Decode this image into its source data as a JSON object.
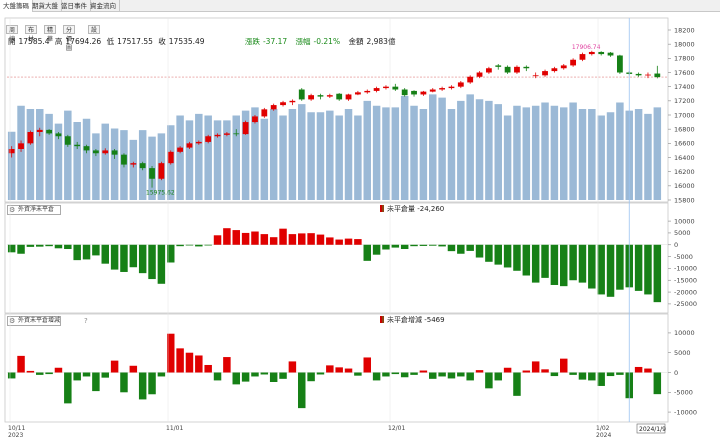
{
  "tabs": [
    "大盤籌碼",
    "期貨大盤",
    "當日事件",
    "資金流向"
  ],
  "subtabs": [
    "周線",
    "布林",
    "精華",
    "分價圖",
    "設"
  ],
  "ohlc": {
    "open_label": "開",
    "open": "17585.4",
    "high_label": "高",
    "high": "17694.26",
    "low_label": "低",
    "low": "17517.55",
    "close_label": "收",
    "close": "17535.49",
    "change_label": "漲跌",
    "change": "-37.17",
    "pct_label": "漲幅",
    "pct": "-0.21%",
    "amount_label": "金額",
    "amount": "2,983億"
  },
  "panel2": {
    "selector": "外資淨未平倉",
    "label": "未平倉量",
    "value": "-24,260"
  },
  "panel3": {
    "selector": "外資未平倉增減",
    "label": "未平倉增減",
    "value": "-5469",
    "help": "?"
  },
  "colors": {
    "up": "#e00000",
    "down": "#168016",
    "volume": "#9bb9d6",
    "hline": "#e08080",
    "cursor": "#9cc4f0",
    "ann_high": "#e040a0",
    "ann_low": "#168016"
  },
  "chart_data": [
    {
      "type": "candlestick",
      "name": "加權指數",
      "ylim": [
        15800,
        18200
      ],
      "yticks": [
        15800,
        16000,
        16200,
        16400,
        16600,
        16800,
        17000,
        17200,
        17400,
        17600,
        17800,
        18000,
        18200
      ],
      "annotations": [
        {
          "text": "17906.74",
          "color": "high"
        },
        {
          "text": "15975.62",
          "color": "low"
        }
      ],
      "ohlc": [
        [
          16460,
          16560,
          16400,
          16520
        ],
        [
          16520,
          16640,
          16480,
          16600
        ],
        [
          16600,
          16780,
          16580,
          16760
        ],
        [
          16760,
          16820,
          16700,
          16790
        ],
        [
          16790,
          16800,
          16720,
          16740
        ],
        [
          16740,
          16760,
          16660,
          16700
        ],
        [
          16700,
          16720,
          16550,
          16580
        ],
        [
          16580,
          16620,
          16520,
          16560
        ],
        [
          16560,
          16580,
          16460,
          16500
        ],
        [
          16500,
          16520,
          16420,
          16460
        ],
        [
          16460,
          16530,
          16440,
          16500
        ],
        [
          16500,
          16520,
          16380,
          16440
        ],
        [
          16440,
          16460,
          16260,
          16300
        ],
        [
          16300,
          16340,
          16260,
          16320
        ],
        [
          16320,
          16340,
          16220,
          16250
        ],
        [
          16250,
          16280,
          15975,
          16100
        ],
        [
          16100,
          16340,
          16080,
          16320
        ],
        [
          16320,
          16500,
          16300,
          16480
        ],
        [
          16480,
          16560,
          16460,
          16540
        ],
        [
          16540,
          16620,
          16520,
          16600
        ],
        [
          16600,
          16640,
          16580,
          16620
        ],
        [
          16620,
          16720,
          16600,
          16700
        ],
        [
          16700,
          16740,
          16680,
          16720
        ],
        [
          16720,
          16760,
          16700,
          16740
        ],
        [
          16740,
          16800,
          16700,
          16730
        ],
        [
          16730,
          16920,
          16720,
          16900
        ],
        [
          16900,
          17000,
          16880,
          16980
        ],
        [
          16980,
          17100,
          16960,
          17080
        ],
        [
          17080,
          17160,
          17060,
          17140
        ],
        [
          17140,
          17200,
          17120,
          17180
        ],
        [
          17180,
          17220,
          17140,
          17200
        ],
        [
          17360,
          17380,
          17200,
          17220
        ],
        [
          17220,
          17300,
          17200,
          17280
        ],
        [
          17280,
          17300,
          17220,
          17260
        ],
        [
          17260,
          17300,
          17240,
          17280
        ],
        [
          17300,
          17310,
          17200,
          17220
        ],
        [
          17220,
          17300,
          17200,
          17290
        ],
        [
          17290,
          17340,
          17280,
          17320
        ],
        [
          17320,
          17360,
          17300,
          17340
        ],
        [
          17340,
          17400,
          17320,
          17380
        ],
        [
          17380,
          17420,
          17360,
          17400
        ],
        [
          17400,
          17440,
          17340,
          17360
        ],
        [
          17360,
          17380,
          17260,
          17280
        ],
        [
          17340,
          17350,
          17260,
          17290
        ],
        [
          17290,
          17340,
          17270,
          17330
        ],
        [
          17330,
          17380,
          17320,
          17360
        ],
        [
          17360,
          17400,
          17340,
          17380
        ],
        [
          17380,
          17420,
          17360,
          17400
        ],
        [
          17400,
          17480,
          17380,
          17460
        ],
        [
          17460,
          17560,
          17440,
          17540
        ],
        [
          17540,
          17620,
          17520,
          17600
        ],
        [
          17600,
          17680,
          17580,
          17660
        ],
        [
          17700,
          17720,
          17640,
          17680
        ],
        [
          17680,
          17700,
          17580,
          17600
        ],
        [
          17600,
          17700,
          17580,
          17680
        ],
        [
          17680,
          17700,
          17620,
          17660
        ],
        [
          17560,
          17600,
          17520,
          17560
        ],
        [
          17560,
          17640,
          17540,
          17620
        ],
        [
          17620,
          17680,
          17600,
          17660
        ],
        [
          17660,
          17720,
          17640,
          17700
        ],
        [
          17700,
          17800,
          17680,
          17780
        ],
        [
          17780,
          17880,
          17760,
          17860
        ],
        [
          17860,
          17906.74,
          17840,
          17890
        ],
        [
          17890,
          17900,
          17840,
          17860
        ],
        [
          17880,
          17890,
          17820,
          17840
        ],
        [
          17840,
          17850,
          17580,
          17600
        ],
        [
          17600,
          17620,
          17560,
          17580
        ],
        [
          17580,
          17600,
          17540,
          17560
        ],
        [
          17560,
          17600,
          17520,
          17570
        ],
        [
          17585.4,
          17694.26,
          17517.55,
          17535.49
        ]
      ],
      "volume_ylim": [
        0,
        4000
      ],
      "volume": [
        2100,
        2900,
        2800,
        2800,
        2650,
        2350,
        2750,
        2400,
        2500,
        2050,
        2350,
        2200,
        2150,
        1850,
        2150,
        1950,
        2050,
        2300,
        2600,
        2450,
        2650,
        2600,
        2450,
        2450,
        2600,
        2750,
        2850,
        2500,
        2800,
        2600,
        2800,
        2950,
        2700,
        2700,
        2750,
        2600,
        2800,
        2600,
        3050,
        2900,
        2850,
        2850,
        3200,
        2900,
        2800,
        3250,
        3150,
        2800,
        3050,
        3250,
        3100,
        3050,
        2950,
        2600,
        2900,
        2850,
        2900,
        3000,
        2900,
        2850,
        3000,
        2800,
        2800,
        2600,
        2700,
        3000,
        2750,
        2800,
        2650,
        2850
      ]
    },
    {
      "type": "bar",
      "name": "未平倉量",
      "ylim": [
        -28000,
        13000
      ],
      "yticks": [
        -25000,
        -20000,
        -15000,
        -10000,
        -5000,
        0,
        5000,
        10000
      ],
      "values": [
        -3200,
        -3800,
        -900,
        -800,
        -600,
        -1500,
        -1800,
        -6500,
        -6200,
        -4500,
        -8000,
        -10500,
        -11500,
        -9500,
        -12000,
        -14500,
        -16500,
        -7500,
        -600,
        -300,
        -700,
        -300,
        4000,
        7000,
        6200,
        5000,
        5600,
        4500,
        3200,
        6800,
        4500,
        4800,
        4900,
        4300,
        3100,
        2200,
        2600,
        2400,
        -6800,
        -4200,
        -2000,
        -1200,
        -1800,
        -600,
        -500,
        -400,
        -700,
        -2700,
        -3800,
        -2600,
        -5400,
        -7200,
        -8400,
        -9600,
        -11000,
        -13000,
        -16000,
        -14000,
        -17000,
        -17500,
        -15000,
        -16000,
        -18500,
        -21000,
        -22000,
        -19000,
        -18000,
        -19500,
        -21000,
        -24260
      ]
    },
    {
      "type": "bar",
      "name": "未平倉增減",
      "ylim": [
        -12000,
        12000
      ],
      "yticks": [
        -10000,
        -5000,
        0,
        5000,
        10000
      ],
      "values": [
        -1500,
        4200,
        400,
        -600,
        -400,
        1200,
        -7800,
        -2000,
        -1000,
        -4700,
        -1300,
        3000,
        -5000,
        1700,
        -6800,
        -5500,
        -1000,
        9800,
        6100,
        5000,
        4300,
        1900,
        -2000,
        3900,
        -3000,
        -2300,
        -1000,
        -500,
        -2400,
        -1600,
        2800,
        -9000,
        -2200,
        -500,
        1800,
        1300,
        1000,
        -800,
        3800,
        -2000,
        -1000,
        -400,
        -1200,
        -600,
        500,
        -1600,
        -1000,
        -1500,
        -1000,
        -2000,
        600,
        -4000,
        -2000,
        1200,
        -5900,
        500,
        2800,
        800,
        -900,
        3500,
        -600,
        -1800,
        -2000,
        -3400,
        -900,
        -600,
        -6500,
        1400,
        1000,
        -5469
      ]
    }
  ],
  "x_axis": [
    {
      "label": "10/11",
      "year": "2023"
    },
    {
      "label": "11/01",
      "year": ""
    },
    {
      "label": "12/01",
      "year": ""
    },
    {
      "label": "1/02",
      "year": "2024"
    }
  ],
  "cursor_date": "2024/1/9"
}
